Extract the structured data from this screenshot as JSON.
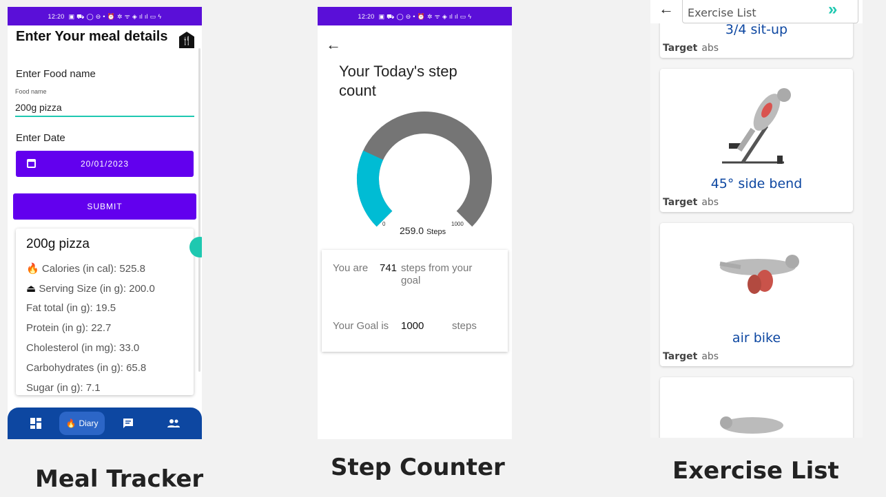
{
  "status_bar": {
    "time": "12:20",
    "icons": "▣ ⛟ ◯ ⊖ •   ⏰ ✲ ᯤ ◈ ıl ıl ▭ ϟ"
  },
  "meal_tracker": {
    "heading": "Enter Your meal details",
    "food_label": "Enter Food name",
    "food_field_hint": "Food name",
    "food_value": "200g pizza",
    "date_label": "Enter Date",
    "date_value": "20/01/2023",
    "submit_label": "SUBMIT",
    "card": {
      "title": "200g pizza",
      "rows": [
        "Calories (in cal): 525.8",
        "Serving Size (in g): 200.0",
        "Fat total (in g): 19.5",
        "Protein (in g): 22.7",
        "Cholesterol (in mg): 33.0",
        "Carbohydrates (in g): 65.8",
        "Sugar (in g): 7.1"
      ]
    },
    "nav": {
      "diary_label": "Diary"
    }
  },
  "step_counter": {
    "title": "Your Today's step count",
    "gauge": {
      "min": "0",
      "max": "1000",
      "value": 259.0,
      "value_text": "259.0",
      "unit": "Steps",
      "colors": {
        "fill": "#00bcd4",
        "track": "#757575"
      }
    },
    "you_are": "You are",
    "remaining": "741",
    "steps_from_goal": "steps from your goal",
    "goal_label": "Your Goal is",
    "goal_value": "1000",
    "steps_word": "steps"
  },
  "exercise_list": {
    "search_value": "Exercise List",
    "partial_top_name": "3/4 sit-up",
    "items": [
      {
        "name": "45° side bend",
        "target_label": "Target",
        "target": "abs"
      },
      {
        "name": "air bike",
        "target_label": "Target",
        "target": "abs"
      }
    ],
    "top_target_label": "Target",
    "top_target": "abs"
  },
  "captions": {
    "meal": "Meal Tracker",
    "steps": "Step Counter",
    "exercise": "Exercise List"
  }
}
